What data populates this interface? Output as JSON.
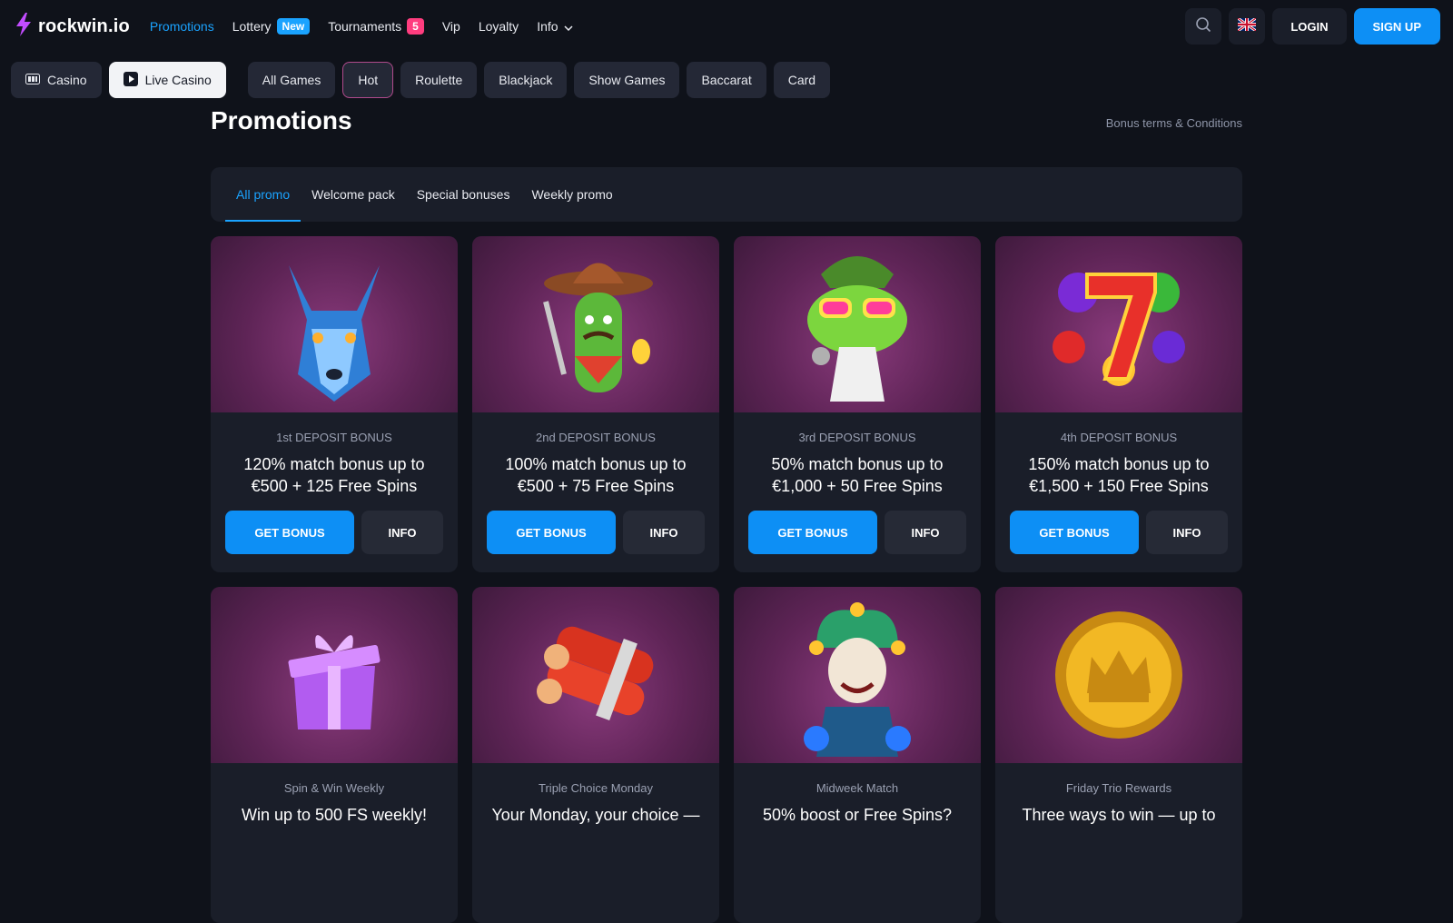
{
  "brand": {
    "name": "rockwin.io",
    "accent": "#1aa3ff"
  },
  "nav": {
    "items": [
      {
        "label": "Promotions"
      },
      {
        "label": "Lottery",
        "badge": "New"
      },
      {
        "label": "Tournaments",
        "badge": "5"
      },
      {
        "label": "Vip"
      },
      {
        "label": "Loyalty"
      },
      {
        "label": "Info"
      }
    ]
  },
  "header": {
    "login_label": "LOGIN",
    "signup_label": "SIGN UP",
    "language_icon": "uk-flag-icon",
    "search_icon": "search-icon"
  },
  "categories": {
    "casino": "Casino",
    "live_casino": "Live Casino",
    "items": [
      "All Games",
      "Hot",
      "Roulette",
      "Blackjack",
      "Show Games",
      "Baccarat",
      "Card"
    ]
  },
  "page": {
    "title": "Promotions",
    "terms_link": "Bonus terms & Conditions"
  },
  "tabs": [
    "All promo",
    "Welcome pack",
    "Special bonuses",
    "Weekly promo"
  ],
  "promos": [
    {
      "label": "1st DEPOSIT BONUS",
      "title_line1": "120% match bonus up to",
      "title_line2": "€500 + 125 Free Spins",
      "get": "GET BONUS",
      "info": "INFO",
      "image": "wolf"
    },
    {
      "label": "2nd DEPOSIT BONUS",
      "title_line1": "100% match bonus up to",
      "title_line2": "€500 + 75 Free Spins",
      "get": "GET BONUS",
      "info": "INFO",
      "image": "cactus-cowboy"
    },
    {
      "label": "3rd DEPOSIT BONUS",
      "title_line1": "50% match bonus up to",
      "title_line2": "€1,000 + 50 Free Spins",
      "get": "GET BONUS",
      "info": "INFO",
      "image": "frog-singer"
    },
    {
      "label": "4th DEPOSIT BONUS",
      "title_line1": "150% match bonus up to",
      "title_line2": "€1,500 + 150 Free Spins",
      "get": "GET BONUS",
      "info": "INFO",
      "image": "lucky-seven"
    },
    {
      "label": "Spin & Win Weekly",
      "title_line1": "Win up to 500 FS weekly!",
      "title_line2": "",
      "image": "gift-box"
    },
    {
      "label": "Triple Choice Monday",
      "title_line1": "Your Monday, your choice —",
      "title_line2": "",
      "image": "dynamite"
    },
    {
      "label": "Midweek Match",
      "title_line1": "50% boost or Free Spins?",
      "title_line2": "",
      "image": "jester"
    },
    {
      "label": "Friday Trio Rewards",
      "title_line1": "Three ways to win — up to",
      "title_line2": "",
      "image": "crown-coin"
    }
  ]
}
